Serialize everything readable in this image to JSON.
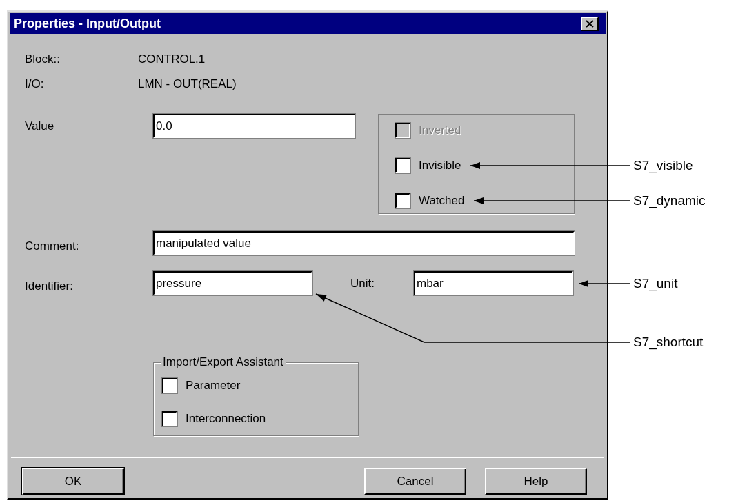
{
  "window": {
    "title": "Properties - Input/Output"
  },
  "info": [
    {
      "label": "Block::",
      "value": "CONTROL.1"
    },
    {
      "label": "I/O:",
      "value": "LMN  -  OUT(REAL)"
    }
  ],
  "value_field": {
    "label": "Value",
    "value": "0.0"
  },
  "options": [
    {
      "label": "Inverted",
      "checked": false,
      "disabled": true
    },
    {
      "label": "Invisible",
      "checked": false,
      "disabled": false,
      "annotation": {
        "text": "S7_visible",
        "kind": "straight"
      }
    },
    {
      "label": "Watched",
      "checked": false,
      "disabled": false,
      "annotation": {
        "text": "S7_dynamic",
        "kind": "straight"
      }
    }
  ],
  "comment_field": {
    "label": "Comment:",
    "value": "manipulated value"
  },
  "identifier_field": {
    "label": "Identifier:",
    "value": "pressure",
    "annotation": {
      "text": "S7_shortcut",
      "kind": "elbow"
    }
  },
  "unit_field": {
    "label": "Unit:",
    "value": "mbar",
    "annotation": {
      "text": "S7_unit",
      "kind": "straight"
    }
  },
  "import_export": {
    "title": "Import/Export Assistant",
    "options": [
      {
        "label": "Parameter",
        "checked": false,
        "disabled": false
      },
      {
        "label": "Interconnection",
        "checked": false,
        "disabled": false
      }
    ]
  },
  "buttons": [
    {
      "label": "OK",
      "default": true
    },
    {
      "label": "Cancel",
      "default": false
    },
    {
      "label": "Help",
      "default": false
    }
  ]
}
